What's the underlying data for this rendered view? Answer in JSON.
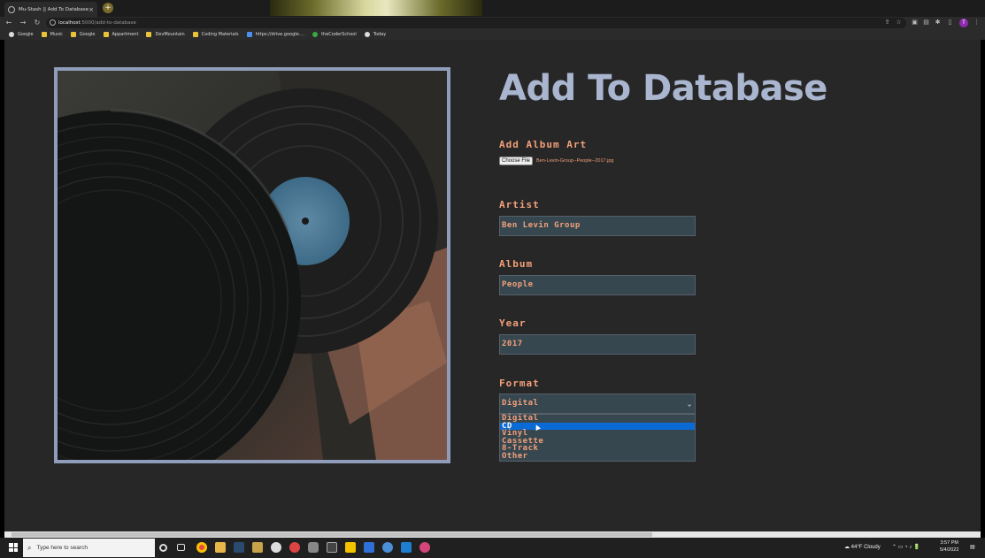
{
  "browser": {
    "tab_title": "Mu-Stash || Add To Database",
    "tab_close": "×",
    "new_tab": "+",
    "url_host": "localhost",
    "url_path": ":5000/add-to-database",
    "profile_initial": "T",
    "bookmarks": [
      {
        "label": "Google",
        "icon": "google-icon"
      },
      {
        "label": "Music",
        "icon": "folder-icon"
      },
      {
        "label": "Google",
        "icon": "folder-icon"
      },
      {
        "label": "Appartment",
        "icon": "folder-icon"
      },
      {
        "label": "DevMountain",
        "icon": "folder-icon"
      },
      {
        "label": "Coding Materials",
        "icon": "folder-icon"
      },
      {
        "label": "https://drive.google....",
        "icon": "drive-icon"
      },
      {
        "label": "theCoderSchool",
        "icon": "coderschool-icon"
      },
      {
        "label": "Today",
        "icon": "today-icon"
      }
    ]
  },
  "page": {
    "title": "Add To Database",
    "album_art_label": "Add Album Art",
    "file_button": "Choose File",
    "file_name": "Ben-Levin-Group--People--2017.jpg",
    "artist_label": "Artist",
    "artist_value": "Ben Levin Group",
    "album_label": "Album",
    "album_value": "People",
    "year_label": "Year",
    "year_value": "2017",
    "format_label": "Format",
    "format_selected": "Digital",
    "format_options": [
      "Digital",
      "CD",
      "Vinyl",
      "Cassette",
      "8-Track",
      "Other"
    ],
    "format_highlighted": "CD"
  },
  "taskbar": {
    "search_placeholder": "Type here to search",
    "weather": "44°F  Cloudy",
    "time": "3:57 PM",
    "date": "5/4/2022"
  },
  "colors": {
    "accent_salmon": "#f3a07a",
    "title_blue": "#aab6cf",
    "field_bg": "#37474f",
    "page_bg": "#272727",
    "selection_blue": "#0a6bd6"
  }
}
